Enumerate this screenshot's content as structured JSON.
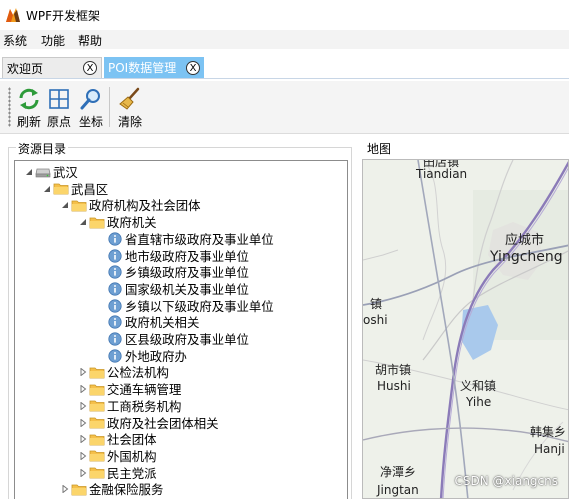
{
  "app": {
    "title": "WPF开发框架",
    "icon": "app-logo-icon"
  },
  "menu": [
    "系统",
    "功能",
    "帮助"
  ],
  "tabs": [
    {
      "label": "欢迎页",
      "active": false,
      "close": "X"
    },
    {
      "label": "POI数据管理",
      "active": true,
      "close": "X"
    }
  ],
  "toolbar": {
    "buttons": [
      {
        "label": "刷新",
        "icon": "refresh-icon"
      },
      {
        "label": "原点",
        "icon": "grid-origin-icon"
      },
      {
        "label": "坐标",
        "icon": "magnifier-icon"
      },
      {
        "label": "清除",
        "icon": "broom-icon"
      }
    ]
  },
  "resource_panel": {
    "title": "资源目录",
    "tree": [
      {
        "label": "武汉",
        "type": "drive",
        "expanded": true,
        "level": 0
      },
      {
        "label": "武昌区",
        "type": "folder",
        "expanded": true,
        "level": 1
      },
      {
        "label": "政府机构及社会团体",
        "type": "folder",
        "expanded": true,
        "level": 2
      },
      {
        "label": "政府机关",
        "type": "folder",
        "expanded": true,
        "level": 3
      },
      {
        "label": "省直辖市级政府及事业单位",
        "type": "info",
        "level": 4
      },
      {
        "label": "地市级政府及事业单位",
        "type": "info",
        "level": 4
      },
      {
        "label": "乡镇级政府及事业单位",
        "type": "info",
        "level": 4
      },
      {
        "label": "国家级机关及事业单位",
        "type": "info",
        "level": 4
      },
      {
        "label": "乡镇以下级政府及事业单位",
        "type": "info",
        "level": 4
      },
      {
        "label": "政府机关相关",
        "type": "info",
        "level": 4
      },
      {
        "label": "区县级政府及事业单位",
        "type": "info",
        "level": 4
      },
      {
        "label": "外地政府办",
        "type": "info",
        "level": 4
      },
      {
        "label": "公检法机构",
        "type": "folder",
        "expanded": false,
        "level": 3
      },
      {
        "label": "交通车辆管理",
        "type": "folder",
        "expanded": false,
        "level": 3
      },
      {
        "label": "工商税务机构",
        "type": "folder",
        "expanded": false,
        "level": 3
      },
      {
        "label": "政府及社会团体相关",
        "type": "folder",
        "expanded": false,
        "level": 3
      },
      {
        "label": "社会团体",
        "type": "folder",
        "expanded": false,
        "level": 3
      },
      {
        "label": "外国机构",
        "type": "folder",
        "expanded": false,
        "level": 3
      },
      {
        "label": "民主党派",
        "type": "folder",
        "expanded": false,
        "level": 3
      },
      {
        "label": "金融保险服务",
        "type": "folder",
        "expanded": false,
        "level": 2
      }
    ]
  },
  "map_panel": {
    "title": "地图",
    "labels": [
      {
        "text": "田店镇",
        "name": "map-label-tiandian-cn"
      },
      {
        "text": "Tiandian",
        "name": "map-label-tiandian-en"
      },
      {
        "text": "应城市",
        "name": "map-label-yingcheng-cn"
      },
      {
        "text": "Yingcheng",
        "name": "map-label-yingcheng-en"
      },
      {
        "text": "镇",
        "name": "map-label-zhen-cn"
      },
      {
        "text": "oshi",
        "name": "map-label-oshi-en"
      },
      {
        "text": "胡市镇",
        "name": "map-label-hushi-cn"
      },
      {
        "text": "Hushi",
        "name": "map-label-hushi-en"
      },
      {
        "text": "义和镇",
        "name": "map-label-yihe-cn"
      },
      {
        "text": "Yihe",
        "name": "map-label-yihe-en"
      },
      {
        "text": "韩集乡",
        "name": "map-label-hanji-cn"
      },
      {
        "text": "Hanji",
        "name": "map-label-hanji-en"
      },
      {
        "text": "净潭乡",
        "name": "map-label-jingtan-cn"
      },
      {
        "text": "Jingtan",
        "name": "map-label-jingtan-en"
      }
    ],
    "watermark": "CSDN @xiangcns"
  }
}
